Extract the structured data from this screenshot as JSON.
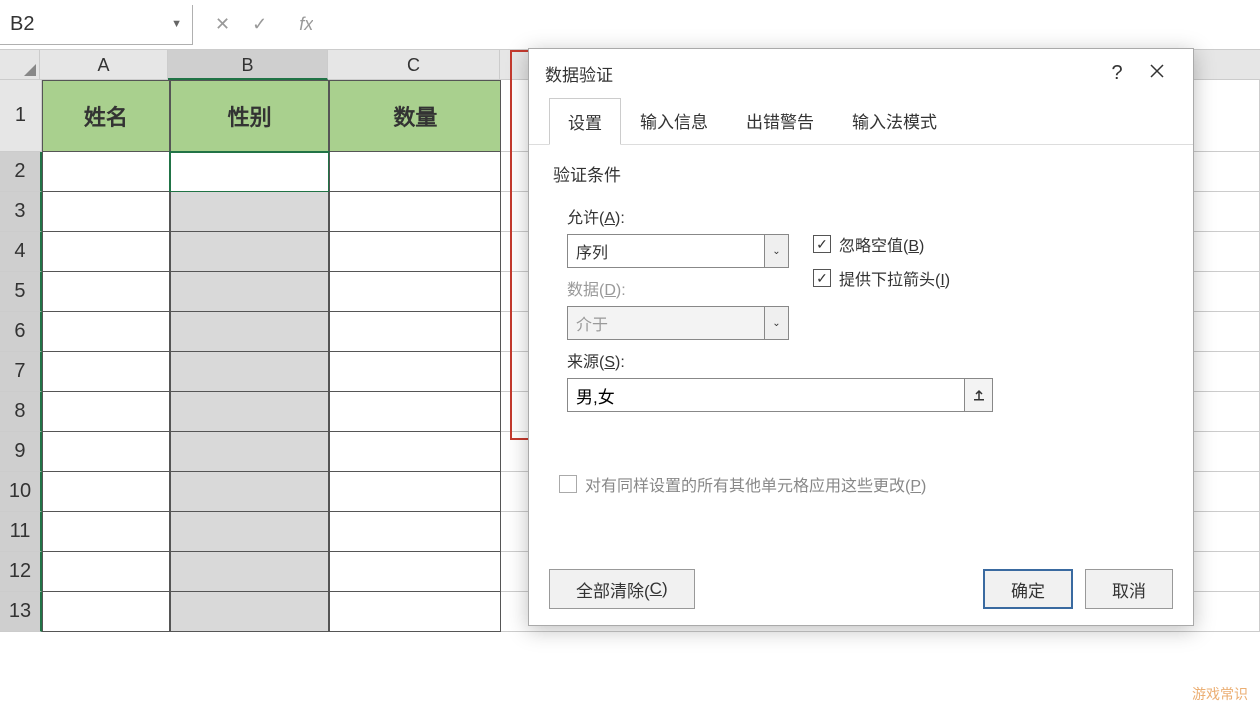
{
  "formula_bar": {
    "cell_ref": "B2",
    "formula": ""
  },
  "columns_visible": [
    "A",
    "B",
    "C"
  ],
  "headers": {
    "A": "姓名",
    "B": "性别",
    "C": "数量"
  },
  "rows_visible": [
    1,
    2,
    3,
    4,
    5,
    6,
    7,
    8,
    9,
    10,
    11,
    12,
    13
  ],
  "active_cell": "B2",
  "selected_range": "B2:B13",
  "dialog": {
    "title": "数据验证",
    "tabs": [
      "设置",
      "输入信息",
      "出错警告",
      "输入法模式"
    ],
    "active_tab": 0,
    "section_label": "验证条件",
    "allow_label": "允许(A):",
    "allow_value": "序列",
    "data_label": "数据(D):",
    "data_value": "介于",
    "source_label": "来源(S):",
    "source_value": "男,女",
    "ignore_blank_label": "忽略空值(B)",
    "ignore_blank_checked": true,
    "dropdown_label": "提供下拉箭头(I)",
    "dropdown_checked": true,
    "apply_label": "对有同样设置的所有其他单元格应用这些更改(P)",
    "apply_checked": false,
    "clear_all": "全部清除(C)",
    "ok": "确定",
    "cancel": "取消"
  },
  "watermark": "游戏常识"
}
